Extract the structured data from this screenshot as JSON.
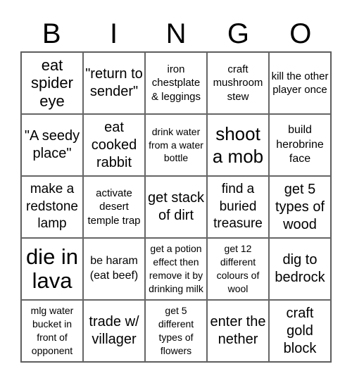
{
  "header": {
    "letters": [
      "B",
      "I",
      "N",
      "G",
      "O"
    ]
  },
  "cells": [
    "eat spider eye",
    "\"return to sender\"",
    "iron chestplate & leggings",
    "craft mushroom stew",
    "kill the other player once",
    "\"A seedy place\"",
    "eat cooked rabbit",
    "drink water from a water bottle",
    "shoot a mob",
    "build herobrine face",
    "make a redstone lamp",
    "activate desert temple trap",
    "get stack of dirt",
    "find a buried treasure",
    "get 5 types of wood",
    "die in lava",
    "be haram (eat beef)",
    "get a potion effect then remove it by drinking milk",
    "get 12 different colours of wool",
    "dig to bedrock",
    "mlg water bucket in front of opponent",
    "trade w/ villager",
    "get 5 different types of flowers",
    "enter the nether",
    "craft gold block"
  ]
}
